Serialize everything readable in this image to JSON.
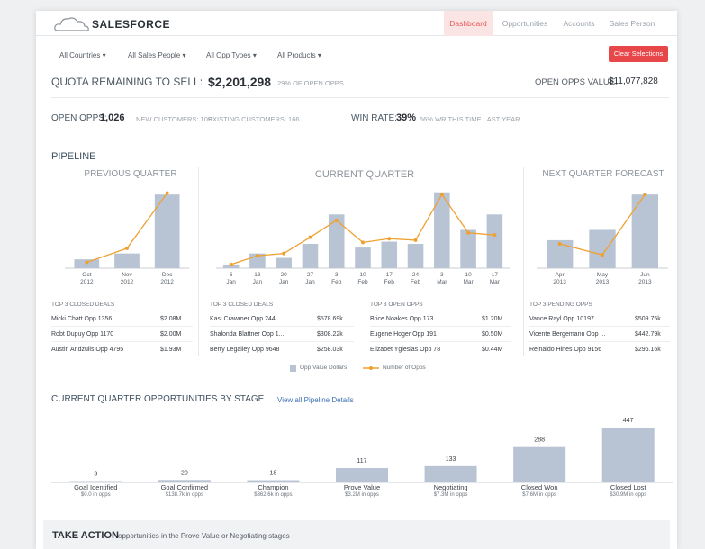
{
  "header": {
    "brand": "SALESFORCE",
    "nav": [
      "Dashboard",
      "Opportunities",
      "Accounts",
      "Sales Person"
    ]
  },
  "filters": [
    "All Countries ▾",
    "All Sales People ▾",
    "All Opp Types ▾",
    "All Products ▾"
  ],
  "clear_label": "Clear Selections",
  "quota": {
    "label": "QUOTA REMAINING TO SELL:",
    "value": "$2,201,298",
    "pct": "29% OF OPEN OPPS",
    "open_value_label": "OPEN OPPS VALUE:",
    "open_value": "$11,077,828"
  },
  "stats": {
    "open_opps_label": "OPEN OPPS:",
    "open_opps": "1,026",
    "new_customers": "NEW CUSTOMERS: 109",
    "existing_customers": "EXISTING CUSTOMERS: 166",
    "win_rate_label": "WIN RATE:",
    "win_rate": "39%",
    "win_rate_note": "56% WR THIS TIME LAST YEAR"
  },
  "pipeline": {
    "title": "PIPELINE",
    "panels": [
      "PREVIOUS QUARTER",
      "CURRENT QUARTER",
      "NEXT QUARTER FORECAST"
    ],
    "legend": [
      "Opp Value Dollars",
      "Number of Opps"
    ],
    "colors": {
      "bar": "#b8c4d3",
      "line": "#f0a030",
      "accent": "#e8474a"
    }
  },
  "chart_data": [
    {
      "type": "bar",
      "categories": [
        [
          "Oct",
          "2012"
        ],
        [
          "Nov",
          "2012"
        ],
        [
          "Dec",
          "2012"
        ]
      ],
      "series": [
        {
          "kind": "bar",
          "values": [
            0.12,
            0.2,
            1.0
          ]
        },
        {
          "kind": "line",
          "values": [
            0.08,
            0.27,
            1.02
          ]
        }
      ],
      "ylim": [
        0,
        1.1
      ]
    },
    {
      "type": "bar",
      "categories": [
        [
          "6",
          "Jan"
        ],
        [
          "13",
          "Jan"
        ],
        [
          "20",
          "Jan"
        ],
        [
          "27",
          "Jan"
        ],
        [
          "3",
          "Feb"
        ],
        [
          "10",
          "Feb"
        ],
        [
          "17",
          "Feb"
        ],
        [
          "24",
          "Feb"
        ],
        [
          "3",
          "Mar"
        ],
        [
          "10",
          "Mar"
        ],
        [
          "17",
          "Mar"
        ]
      ],
      "series": [
        {
          "kind": "bar",
          "values": [
            0.05,
            0.2,
            0.14,
            0.33,
            0.73,
            0.28,
            0.36,
            0.33,
            1.03,
            0.52,
            0.73
          ]
        },
        {
          "kind": "line",
          "values": [
            0.05,
            0.17,
            0.2,
            0.42,
            0.65,
            0.35,
            0.4,
            0.38,
            1.0,
            0.48,
            0.45
          ]
        }
      ],
      "ylim": [
        0,
        1.1
      ]
    },
    {
      "type": "bar",
      "categories": [
        [
          "Apr",
          "2013"
        ],
        [
          "May",
          "2013"
        ],
        [
          "Jun",
          "2013"
        ]
      ],
      "series": [
        {
          "kind": "bar",
          "values": [
            0.38,
            0.52,
            1.0
          ]
        },
        {
          "kind": "line",
          "values": [
            0.33,
            0.18,
            1.0
          ]
        }
      ],
      "ylim": [
        0,
        1.1
      ]
    },
    {
      "type": "bar",
      "title": "CURRENT QUARTER OPPORTUNITIES BY STAGE",
      "categories": [
        "Goal Identified",
        "Goal Confirmed",
        "Champion",
        "Prove Value",
        "Negotiating",
        "Closed Won",
        "Closed Lost"
      ],
      "values": [
        3,
        20,
        18,
        117,
        133,
        288,
        447
      ],
      "sublabels": [
        "$0.0 in opps",
        "$138.7k in opps",
        "$362.6k in opps",
        "$3.2M in opps",
        "$7.3M in opps",
        "$7.6M in opps",
        "$30.9M in opps"
      ],
      "ylim": [
        0,
        447
      ]
    }
  ],
  "deals": {
    "closed_prev": {
      "head": "TOP 3 CLOSED DEALS",
      "rows": [
        [
          "Micki Chatt Opp 1356",
          "$2.08M"
        ],
        [
          "Robt Dupuy Opp 1170",
          "$2.00M"
        ],
        [
          "Austin Andzulis Opp 4795",
          "$1.93M"
        ]
      ]
    },
    "closed_cur": {
      "head": "TOP 3 CLOSED DEALS",
      "rows": [
        [
          "Kasi Crawmer Opp 244",
          "$578.69k"
        ],
        [
          "Shalonda Blattner Opp 1...",
          "$308.22k"
        ],
        [
          "Berry Legalley Opp 9648",
          "$258.03k"
        ]
      ]
    },
    "open_cur": {
      "head": "TOP 3 OPEN OPPS",
      "rows": [
        [
          "Brice Noakes Opp 173",
          "$1.20M"
        ],
        [
          "Eugene Hoger Opp 191",
          "$0.50M"
        ],
        [
          "Elizabet Yglesias Opp 78",
          "$0.44M"
        ]
      ]
    },
    "pending_next": {
      "head": "TOP 3 PENDING OPPS",
      "rows": [
        [
          "Vance Rayl Opp 10197",
          "$509.75k"
        ],
        [
          "Vicente Bergemann Opp ...",
          "$442.79k"
        ],
        [
          "Reinaldo Hines Opp 9156",
          "$296.16k"
        ]
      ]
    }
  },
  "stage": {
    "title": "CURRENT QUARTER OPPORTUNITIES BY STAGE",
    "link": "View all Pipeline Details"
  },
  "take_action": {
    "title": "TAKE ACTION",
    "subtitle": "opportunities in the Prove Value or Negotiating stages"
  }
}
